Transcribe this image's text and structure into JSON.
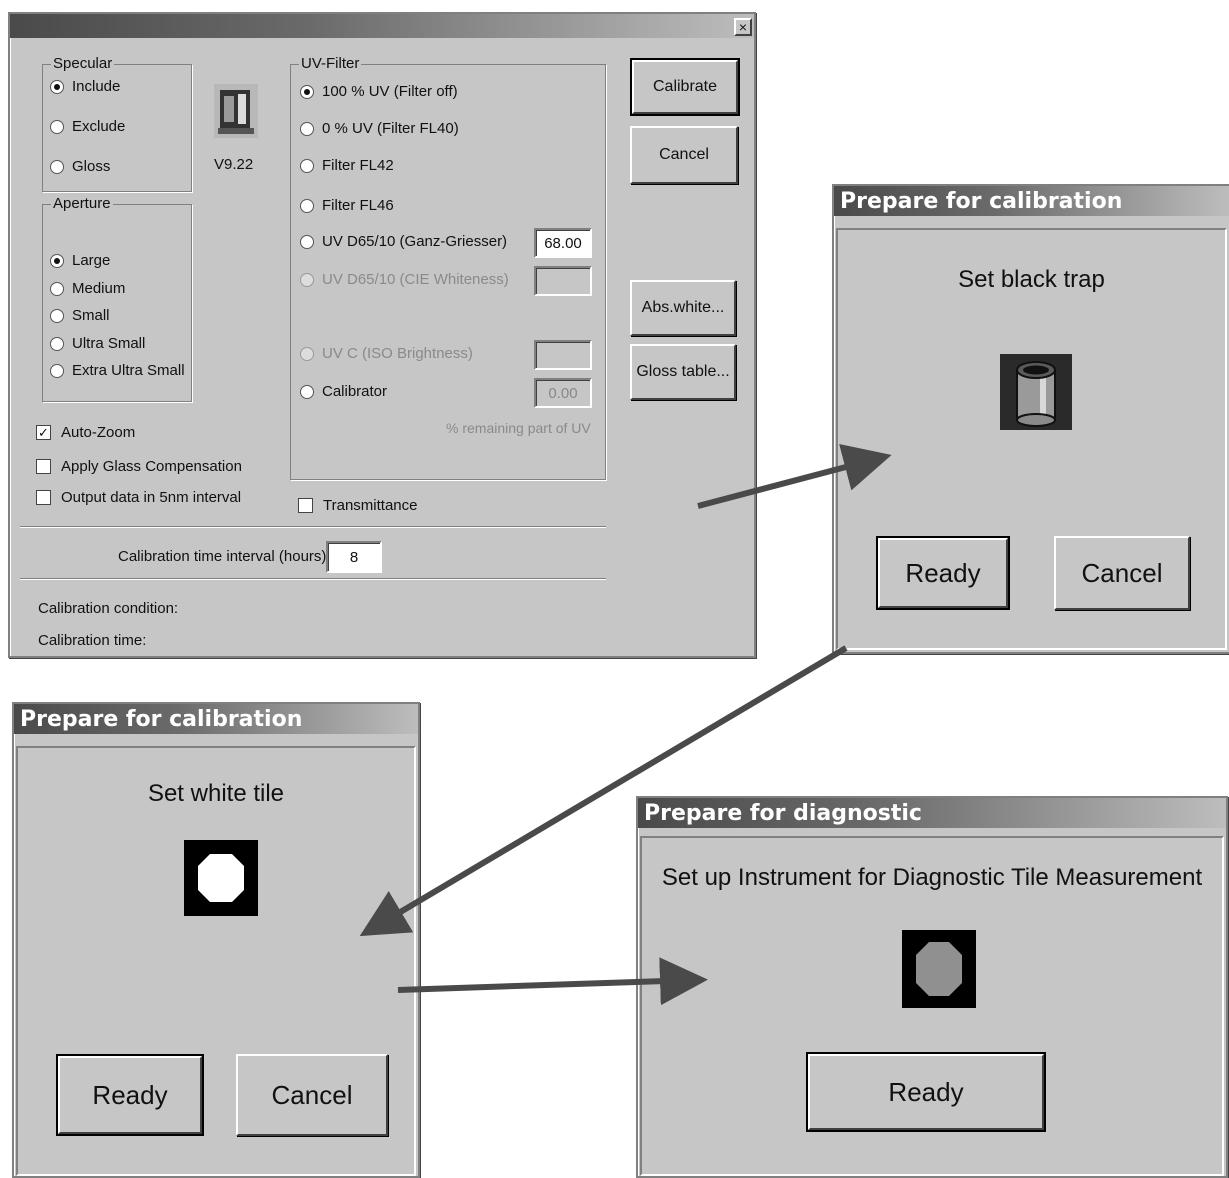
{
  "main_dialog": {
    "close_glyph": "×",
    "specular": {
      "label": "Specular",
      "options": [
        "Include",
        "Exclude",
        "Gloss"
      ],
      "selected": "Include"
    },
    "version": "V9.22",
    "aperture": {
      "label": "Aperture",
      "options": [
        "Large",
        "Medium",
        "Small",
        "Ultra Small",
        "Extra Ultra Small"
      ],
      "selected": "Large"
    },
    "uv_filter": {
      "label": "UV-Filter",
      "options": [
        "100 % UV (Filter off)",
        "0 % UV (Filter FL40)",
        "Filter FL42",
        "Filter FL46",
        "UV D65/10 (Ganz-Griesser)",
        "UV D65/10 (CIE Whiteness)",
        "UV C (ISO Brightness)",
        "Calibrator"
      ],
      "selected": "100 % UV (Filter off)",
      "ganz_value": "68.00",
      "calibrator_value": "0.00",
      "remaining_note": "% remaining part of UV"
    },
    "buttons": {
      "calibrate": "Calibrate",
      "cancel": "Cancel",
      "abs_white": "Abs.white...",
      "gloss_table": "Gloss table..."
    },
    "checkboxes": {
      "auto_zoom": "Auto-Zoom",
      "auto_zoom_checked": true,
      "glass": "Apply Glass Compensation",
      "output_5nm": "Output data in 5nm interval",
      "transmittance": "Transmittance"
    },
    "interval_label": "Calibration time interval (hours):",
    "interval_value": "8",
    "condition_label": "Calibration condition:",
    "time_label": "Calibration time:"
  },
  "black_trap_dialog": {
    "title": "Prepare for calibration",
    "message": "Set black trap",
    "ready": "Ready",
    "cancel": "Cancel"
  },
  "white_tile_dialog": {
    "title": "Prepare for calibration",
    "message": "Set white tile",
    "ready": "Ready",
    "cancel": "Cancel"
  },
  "diagnostic_dialog": {
    "title": "Prepare for diagnostic",
    "message": "Set up Instrument for Diagnostic Tile Measurement",
    "ready": "Ready"
  },
  "colors": {
    "dialog_bg": "#c6c6c6",
    "arrow": "#4a4a4a"
  }
}
